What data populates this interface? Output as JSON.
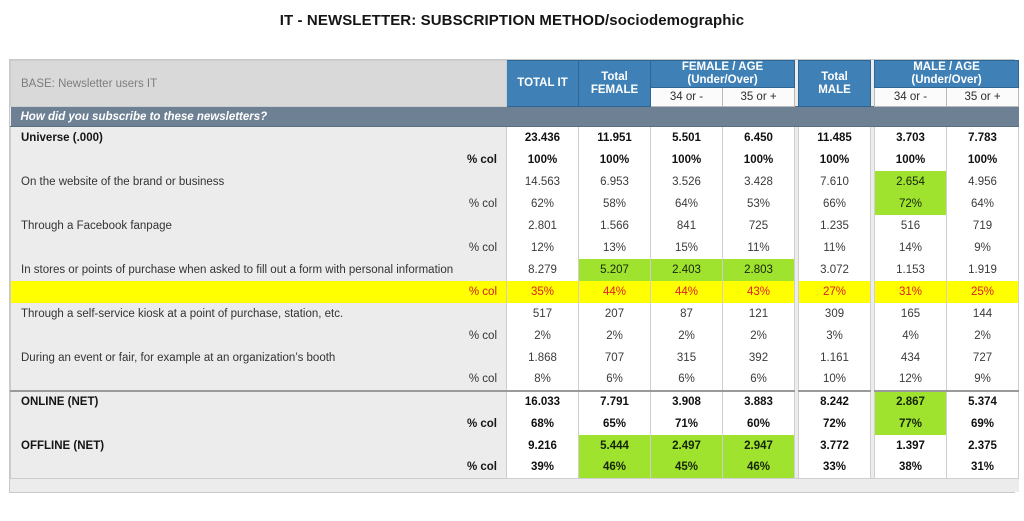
{
  "title": "IT - NEWSLETTER: SUBSCRIPTION METHOD/sociodemographic",
  "table": {
    "base_label": "BASE: Newsletter users IT",
    "banner": "How did you subscribe to these newsletters?",
    "columns": [
      {
        "key": "total_it",
        "label": "TOTAL IT",
        "group": null,
        "sub": null
      },
      {
        "key": "total_female",
        "label": "Total FEMALE",
        "group": null,
        "sub": null
      },
      {
        "key": "female_u34",
        "label": "34 or -",
        "group": "FEMALE / AGE (Under/Over)",
        "sub": "34 or -"
      },
      {
        "key": "female_o35",
        "label": "35 or +",
        "group": "FEMALE / AGE (Under/Over)",
        "sub": "35 or +"
      },
      {
        "key": "total_male",
        "label": "Total MALE",
        "group": null,
        "sub": null
      },
      {
        "key": "male_u34",
        "label": "34 or -",
        "group": "MALE / AGE (Under/Over)",
        "sub": "34 or -"
      },
      {
        "key": "male_o35",
        "label": "35 or +",
        "group": "MALE / AGE (Under/Over)",
        "sub": "35 or +"
      }
    ],
    "header": {
      "total_it": "TOTAL IT",
      "total_female_line1": "Total",
      "total_female_line2": "FEMALE",
      "female_group_line1": "FEMALE / AGE",
      "female_group_line2": "(Under/Over)",
      "female_sub_u34": "34 or -",
      "female_sub_o35": "35 or +",
      "total_male_line1": "Total",
      "total_male_line2": "MALE",
      "male_group_line1": "MALE / AGE",
      "male_group_line2": "(Under/Over)",
      "male_sub_u34": "34 or -",
      "male_sub_o35": "35 or +"
    },
    "pct_label": "% col",
    "rows": [
      {
        "label": "Universe (.000)",
        "bold": true,
        "counts": [
          "23.436",
          "11.951",
          "5.501",
          "6.450",
          "11.485",
          "3.703",
          "7.783"
        ],
        "counts_hl": [
          false,
          false,
          false,
          false,
          false,
          false,
          false
        ],
        "pcts": [
          "100%",
          "100%",
          "100%",
          "100%",
          "100%",
          "100%",
          "100%"
        ],
        "pcts_hl": [
          false,
          false,
          false,
          false,
          false,
          false,
          false
        ],
        "pct_yellow": false
      },
      {
        "label": "On the website of the brand or business",
        "bold": false,
        "counts": [
          "14.563",
          "6.953",
          "3.526",
          "3.428",
          "7.610",
          "2.654",
          "4.956"
        ],
        "counts_hl": [
          false,
          false,
          false,
          false,
          false,
          true,
          false
        ],
        "pcts": [
          "62%",
          "58%",
          "64%",
          "53%",
          "66%",
          "72%",
          "64%"
        ],
        "pcts_hl": [
          false,
          false,
          false,
          false,
          false,
          true,
          false
        ],
        "pct_yellow": false
      },
      {
        "label": "Through a Facebook fanpage",
        "bold": false,
        "counts": [
          "2.801",
          "1.566",
          "841",
          "725",
          "1.235",
          "516",
          "719"
        ],
        "counts_hl": [
          false,
          false,
          false,
          false,
          false,
          false,
          false
        ],
        "pcts": [
          "12%",
          "13%",
          "15%",
          "11%",
          "11%",
          "14%",
          "9%"
        ],
        "pcts_hl": [
          false,
          false,
          false,
          false,
          false,
          false,
          false
        ],
        "pct_yellow": false
      },
      {
        "label": "In stores or points of purchase when asked to fill out a form with personal information",
        "bold": false,
        "counts": [
          "8.279",
          "5.207",
          "2.403",
          "2.803",
          "3.072",
          "1.153",
          "1.919"
        ],
        "counts_hl": [
          false,
          true,
          true,
          true,
          false,
          false,
          false
        ],
        "pcts": [
          "35%",
          "44%",
          "44%",
          "43%",
          "27%",
          "31%",
          "25%"
        ],
        "pcts_hl": [
          false,
          false,
          false,
          false,
          false,
          false,
          false
        ],
        "pct_yellow": true
      },
      {
        "label": "Through a self-service kiosk at a point of purchase, station, etc.",
        "bold": false,
        "counts": [
          "517",
          "207",
          "87",
          "121",
          "309",
          "165",
          "144"
        ],
        "counts_hl": [
          false,
          false,
          false,
          false,
          false,
          false,
          false
        ],
        "pcts": [
          "2%",
          "2%",
          "2%",
          "2%",
          "3%",
          "4%",
          "2%"
        ],
        "pcts_hl": [
          false,
          false,
          false,
          false,
          false,
          false,
          false
        ],
        "pct_yellow": false
      },
      {
        "label": "During an event or fair, for example at an organization’s booth",
        "bold": false,
        "counts": [
          "1.868",
          "707",
          "315",
          "392",
          "1.161",
          "434",
          "727"
        ],
        "counts_hl": [
          false,
          false,
          false,
          false,
          false,
          false,
          false
        ],
        "pcts": [
          "8%",
          "6%",
          "6%",
          "6%",
          "10%",
          "12%",
          "9%"
        ],
        "pcts_hl": [
          false,
          false,
          false,
          false,
          false,
          false,
          false
        ],
        "pct_yellow": false
      },
      {
        "label": "ONLINE (NET)",
        "bold": true,
        "section_top": true,
        "counts": [
          "16.033",
          "7.791",
          "3.908",
          "3.883",
          "8.242",
          "2.867",
          "5.374"
        ],
        "counts_hl": [
          false,
          false,
          false,
          false,
          false,
          true,
          false
        ],
        "pcts": [
          "68%",
          "65%",
          "71%",
          "60%",
          "72%",
          "77%",
          "69%"
        ],
        "pcts_hl": [
          false,
          false,
          false,
          false,
          false,
          true,
          false
        ],
        "pct_yellow": false
      },
      {
        "label": "OFFLINE (NET)",
        "bold": true,
        "counts": [
          "9.216",
          "5.444",
          "2.497",
          "2.947",
          "3.772",
          "1.397",
          "2.375"
        ],
        "counts_hl": [
          false,
          true,
          true,
          true,
          false,
          false,
          false
        ],
        "pcts": [
          "39%",
          "46%",
          "45%",
          "46%",
          "33%",
          "38%",
          "31%"
        ],
        "pcts_hl": [
          false,
          true,
          true,
          true,
          false,
          false,
          false
        ],
        "pct_yellow": false
      }
    ],
    "colors": {
      "header_blue": "#3f80b6",
      "banner_slate": "#6e8094",
      "highlight_green": "#9fe32e",
      "highlight_yellow": "#ffff00",
      "highlight_yellow_text": "#e02020",
      "label_bg": "#ececec"
    }
  }
}
